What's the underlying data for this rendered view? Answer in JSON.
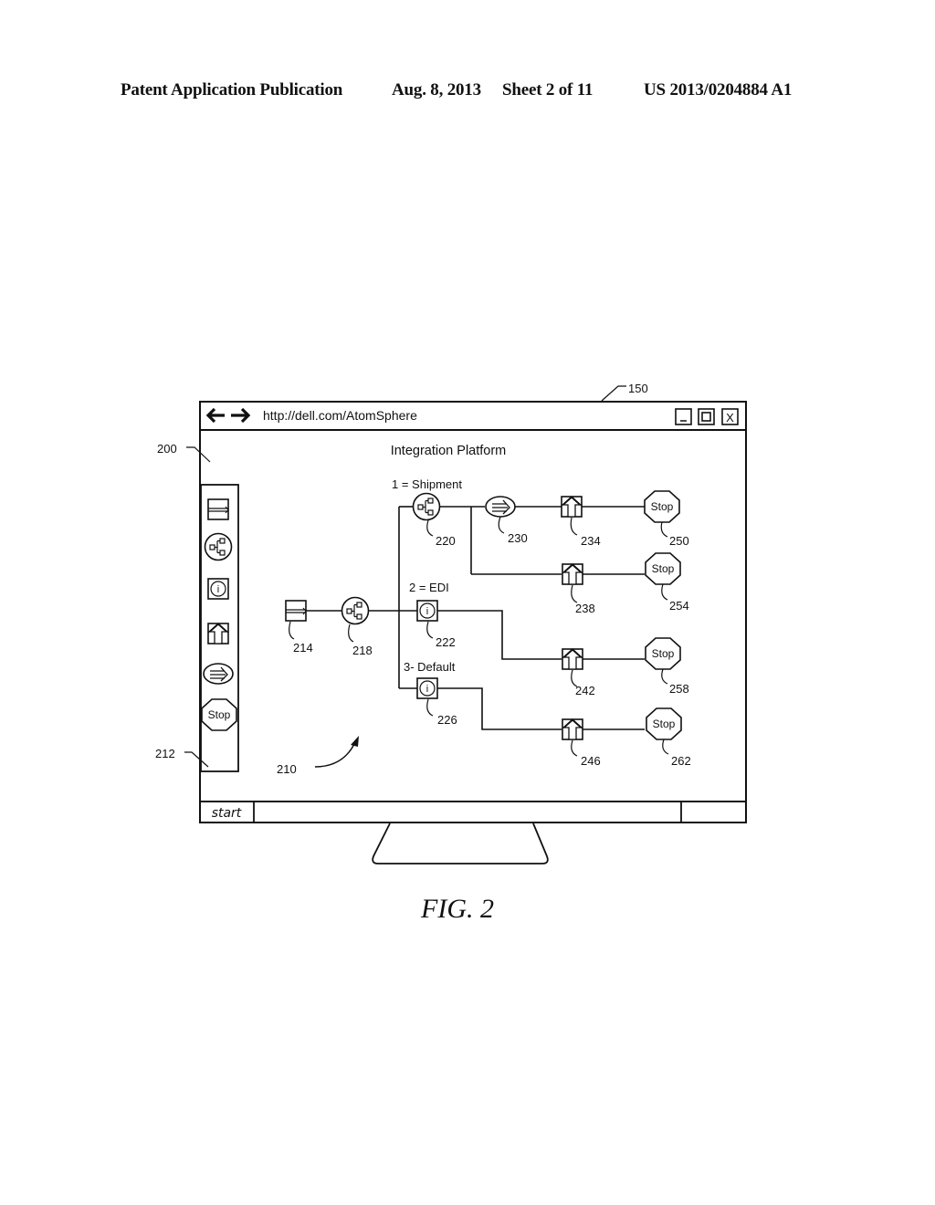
{
  "header": {
    "publication": "Patent Application Publication",
    "date": "Aug. 8, 2013",
    "sheet": "Sheet 2 of 11",
    "patent_number": "US 2013/0204884 A1"
  },
  "window": {
    "url": "http://dell.com/AtomSphere",
    "title": "Integration Platform",
    "back_icon": "arrow-left",
    "forward_icon": "arrow-right",
    "minimize_label": "_",
    "maximize_icon": "square",
    "close_label": "X"
  },
  "palette": {
    "items": [
      {
        "icon": "connector-icon"
      },
      {
        "icon": "decision-icon"
      },
      {
        "icon": "info-icon"
      },
      {
        "icon": "upload-icon"
      },
      {
        "icon": "route-icon"
      },
      {
        "icon": "stop-icon",
        "label": "Stop"
      }
    ]
  },
  "diagram": {
    "branch_labels": {
      "shipment": "1 = Shipment",
      "edi": "2 = EDI",
      "default": "3- Default"
    },
    "stop_label": "Stop",
    "refs": {
      "r150": "150",
      "r200": "200",
      "r210": "210",
      "r212": "212",
      "r214": "214",
      "r218": "218",
      "r220": "220",
      "r222": "222",
      "r226": "226",
      "r230": "230",
      "r234": "234",
      "r238": "238",
      "r242": "242",
      "r246": "246",
      "r250": "250",
      "r254": "254",
      "r258": "258",
      "r262": "262"
    }
  },
  "taskbar": {
    "start_label": "start"
  },
  "figure": {
    "caption": "FIG. 2"
  },
  "colors": {
    "ink": "#111111",
    "background": "#ffffff"
  }
}
